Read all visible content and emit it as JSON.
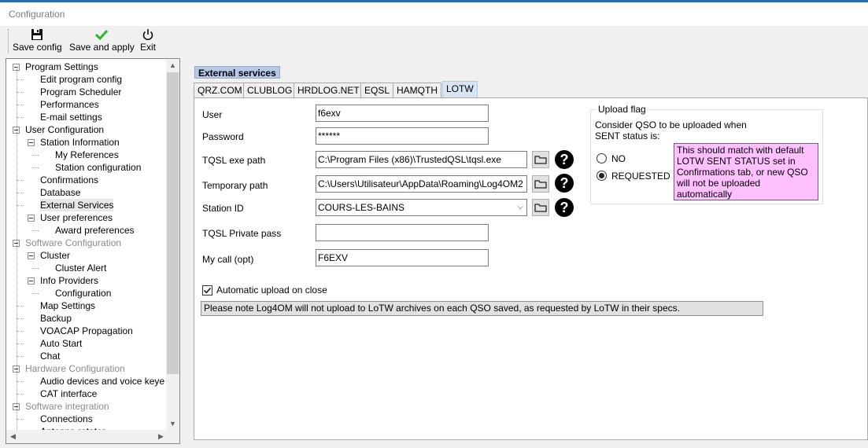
{
  "window": {
    "title": "Configuration"
  },
  "toolbar": {
    "save_config": "Save config",
    "save_apply": "Save and apply",
    "exit": "Exit"
  },
  "tree": [
    {
      "label": "Program Settings",
      "level": 0,
      "expand": true,
      "disabled": false
    },
    {
      "label": "Edit program config",
      "level": 1
    },
    {
      "label": "Program Scheduler",
      "level": 1
    },
    {
      "label": "Performances",
      "level": 1
    },
    {
      "label": "E-mail settings",
      "level": 1
    },
    {
      "label": "User Configuration",
      "level": 0,
      "expand": true
    },
    {
      "label": "Station Information",
      "level": 1,
      "expand": true
    },
    {
      "label": "My References",
      "level": 2
    },
    {
      "label": "Station configuration",
      "level": 2
    },
    {
      "label": "Confirmations",
      "level": 1
    },
    {
      "label": "Database",
      "level": 1
    },
    {
      "label": "External Services",
      "level": 1,
      "selected": true
    },
    {
      "label": "User preferences",
      "level": 1,
      "expand": true
    },
    {
      "label": "Award preferences",
      "level": 2
    },
    {
      "label": "Software Configuration",
      "level": 0,
      "expand": true,
      "disabled": true
    },
    {
      "label": "Cluster",
      "level": 1,
      "expand": true
    },
    {
      "label": "Cluster Alert",
      "level": 2
    },
    {
      "label": "Info Providers",
      "level": 1,
      "expand": true
    },
    {
      "label": "Configuration",
      "level": 2
    },
    {
      "label": "Map Settings",
      "level": 1
    },
    {
      "label": "Backup",
      "level": 1
    },
    {
      "label": "VOACAP Propagation",
      "level": 1
    },
    {
      "label": "Auto Start",
      "level": 1
    },
    {
      "label": "Chat",
      "level": 1
    },
    {
      "label": "Hardware Configuration",
      "level": 0,
      "expand": true,
      "disabled": true
    },
    {
      "label": "Audio devices and voice keye",
      "level": 1
    },
    {
      "label": "CAT interface",
      "level": 1
    },
    {
      "label": "Software integration",
      "level": 0,
      "expand": true,
      "disabled": true
    },
    {
      "label": "Connections",
      "level": 1
    },
    {
      "label": "Antenna rotator",
      "level": 1
    }
  ],
  "section_title": "External services",
  "tabs": [
    "QRZ.COM",
    "CLUBLOG",
    "HRDLOG.NET",
    "EQSL",
    "HAMQTH",
    "LOTW"
  ],
  "active_tab": "LOTW",
  "form": {
    "user_label": "User",
    "user_value": "f6exv",
    "password_label": "Password",
    "password_value": "******",
    "tqsl_path_label": "TQSL exe path",
    "tqsl_path_value": "C:\\Program Files (x86)\\TrustedQSL\\tqsl.exe",
    "temp_path_label": "Temporary path",
    "temp_path_value": "C:\\Users\\Utilisateur\\AppData\\Roaming\\Log4OM2",
    "station_label": "Station ID",
    "station_value": "COURS-LES-BAINS",
    "private_pass_label": "TQSL Private pass",
    "private_pass_value": "",
    "mycall_label": "My call (opt)",
    "mycall_value": "F6EXV",
    "auto_upload_label": "Automatic upload on close",
    "auto_upload_checked": true,
    "note": "Please note Log4OM will not upload to LoTW archives on each QSO saved, as requested by LoTW in their specs."
  },
  "upload_flag": {
    "title": "Upload flag",
    "desc_line1": "Consider QSO to be uploaded when",
    "desc_line2": "SENT status is:",
    "option_no": "NO",
    "option_requested": "REQUESTED",
    "selected": "REQUESTED",
    "hint": "This should match with default LOTW SENT STATUS set in Confirmations tab, or new QSO will not be uploaded automatically"
  },
  "icons": [
    "save-icon",
    "check-icon",
    "power-icon",
    "folder-icon",
    "help-icon"
  ],
  "colors": {
    "section_bg": "#b4c8e6",
    "hint_bg": "#ffc0ff",
    "active_tab_bg": "#d6e4f3",
    "check_green": "#2fb52f"
  }
}
